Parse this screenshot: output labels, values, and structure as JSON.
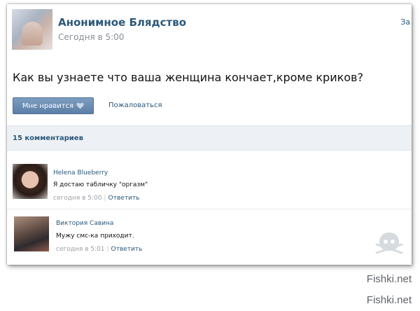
{
  "post": {
    "author": "Анонимное Блядство",
    "time": "Сегодня в 5:00",
    "corner_text": "За",
    "text": "Как вы узнаете что ваша женщина кончает,кроме криков?",
    "like_label": "Мне нравится",
    "report_label": "Пожаловаться",
    "heart_icon": "heart-icon"
  },
  "comments_header": {
    "label": "15 комментариев"
  },
  "comments": [
    {
      "name": "Helena Blueberry",
      "text": "Я достаю табличку \"оргазм\"",
      "time": "сегодня в 5:00",
      "reply": "Ответить"
    },
    {
      "name": "Виктория Савина",
      "text": "Мужу смс-ка приходит.",
      "time": "сегодня в 5:01",
      "reply": "Ответить"
    }
  ],
  "credits": [
    "Fishki.net",
    "Fishki.net"
  ],
  "colors": {
    "link": "#2b587a",
    "button": "#5d7fa7",
    "bar": "#edf1f5"
  }
}
